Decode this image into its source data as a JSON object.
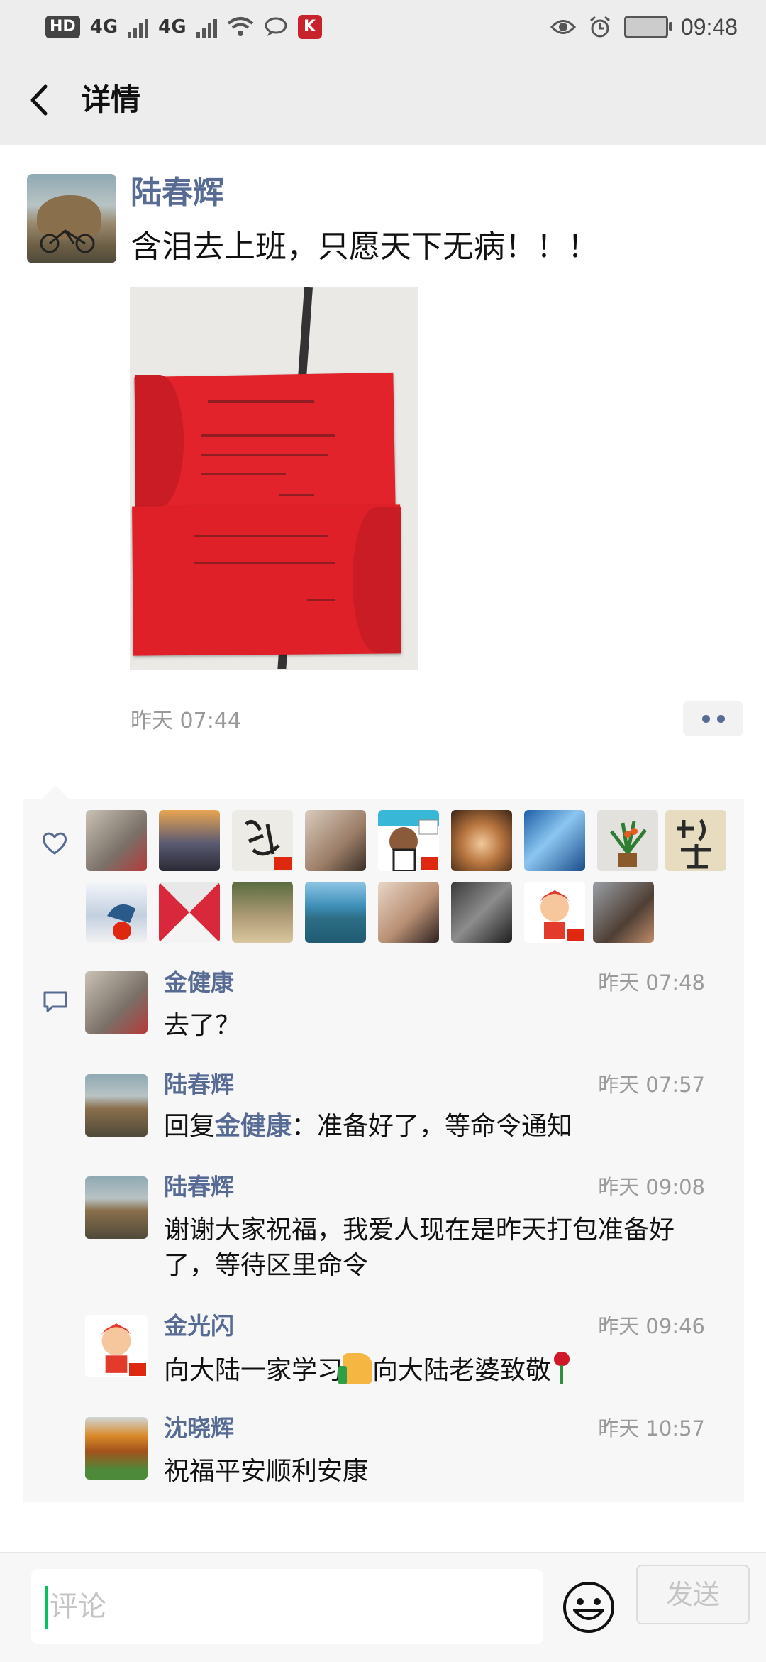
{
  "status_bar": {
    "hd_label": "HD",
    "net1": "4G",
    "net2": "4G",
    "time": "09:48"
  },
  "header": {
    "title": "详情"
  },
  "post": {
    "author": "陆春辉",
    "text": "含泪去上班，只愿天下无病！！！",
    "time": "昨天 07:44"
  },
  "likes": {
    "count_shown": 17
  },
  "comments": [
    {
      "name": "金健康",
      "time": "昨天 07:48",
      "text": "去了？"
    },
    {
      "name": "陆春辉",
      "time": "昨天 07:57",
      "reply_prefix": "回复",
      "reply_to": "金健康",
      "text": "：准备好了，等命令通知"
    },
    {
      "name": "陆春辉",
      "time": "昨天 09:08",
      "text": "谢谢大家祝福，我爱人现在是昨天打包准备好了，等待区里命令"
    },
    {
      "name": "金光闪",
      "time": "昨天 09:46",
      "text_a": "向大陆一家学习",
      "text_b": "向大陆老婆致敬"
    },
    {
      "name": "沈晓辉",
      "time": "昨天 10:57",
      "text": "祝福平安顺利安康"
    }
  ],
  "composer": {
    "placeholder": "评论",
    "send_label": "发送"
  },
  "colors": {
    "link_blue": "#576b95",
    "accent_green": "#07c160",
    "panel_bg": "#f7f7f7"
  }
}
